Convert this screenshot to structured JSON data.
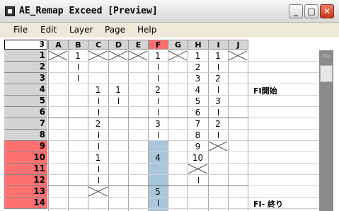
{
  "window": {
    "title": "AE_Remap Exceed [Preview]"
  },
  "menu": [
    "File",
    "Edit",
    "Layer",
    "Page",
    "Help"
  ],
  "frame_box": "3",
  "columns": [
    "A",
    "B",
    "C",
    "D",
    "E",
    "F",
    "G",
    "H",
    "I",
    "J"
  ],
  "selected_column": "F",
  "rows": [
    "1",
    "2",
    "3",
    "4",
    "5",
    "6",
    "7",
    "8",
    "9",
    "10",
    "11",
    "12",
    "13",
    "14"
  ],
  "red_rows": [
    "9",
    "10",
    "11",
    "12",
    "13",
    "14"
  ],
  "memos": [
    {
      "row": 4,
      "text": "FI開始"
    },
    {
      "row": 14,
      "text": "FI- 終り"
    }
  ],
  "scroll": {
    "top_label": "Top"
  },
  "colors": {
    "selected_header": "#ff6f6f",
    "red_row": "#ff7070",
    "blue_fill": "#a9c8dc"
  },
  "cells": [
    {
      "r": 1,
      "c": "B",
      "v": "1"
    },
    {
      "r": 1,
      "c": "F",
      "v": "1"
    },
    {
      "r": 1,
      "c": "H",
      "v": "1"
    },
    {
      "r": 1,
      "c": "I",
      "v": "1"
    },
    {
      "r": 2,
      "c": "H",
      "v": "2"
    },
    {
      "r": 3,
      "c": "H",
      "v": "3"
    },
    {
      "r": 3,
      "c": "I",
      "v": "2"
    },
    {
      "r": 4,
      "c": "C",
      "v": "1"
    },
    {
      "r": 4,
      "c": "D",
      "v": "1"
    },
    {
      "r": 4,
      "c": "F",
      "v": "2"
    },
    {
      "r": 4,
      "c": "H",
      "v": "4"
    },
    {
      "r": 5,
      "c": "H",
      "v": "5"
    },
    {
      "r": 5,
      "c": "I",
      "v": "3"
    },
    {
      "r": 6,
      "c": "H",
      "v": "6"
    },
    {
      "r": 7,
      "c": "C",
      "v": "2"
    },
    {
      "r": 7,
      "c": "F",
      "v": "3"
    },
    {
      "r": 7,
      "c": "H",
      "v": "7"
    },
    {
      "r": 7,
      "c": "I",
      "v": "2"
    },
    {
      "r": 8,
      "c": "H",
      "v": "8"
    },
    {
      "r": 9,
      "c": "H",
      "v": "9"
    },
    {
      "r": 10,
      "c": "C",
      "v": "1"
    },
    {
      "r": 10,
      "c": "F",
      "v": "4"
    },
    {
      "r": 10,
      "c": "H",
      "v": "10"
    },
    {
      "r": 13,
      "c": "F",
      "v": "5"
    }
  ],
  "x_cells": [
    {
      "r": 1,
      "c": "A"
    },
    {
      "r": 1,
      "c": "C"
    },
    {
      "r": 1,
      "c": "D"
    },
    {
      "r": 1,
      "c": "E"
    },
    {
      "r": 1,
      "c": "G"
    },
    {
      "r": 1,
      "c": "J"
    },
    {
      "r": 9,
      "c": "I"
    },
    {
      "r": 11,
      "c": "H"
    },
    {
      "r": 13,
      "c": "C"
    }
  ],
  "dashes": [
    {
      "r": 2,
      "c": "B"
    },
    {
      "r": 3,
      "c": "B"
    },
    {
      "r": 2,
      "c": "F"
    },
    {
      "r": 3,
      "c": "F"
    },
    {
      "r": 2,
      "c": "I"
    },
    {
      "r": 4,
      "c": "I"
    },
    {
      "r": 5,
      "c": "C"
    },
    {
      "r": 6,
      "c": "C"
    },
    {
      "r": 5,
      "c": "D"
    },
    {
      "r": 5,
      "c": "F"
    },
    {
      "r": 6,
      "c": "F"
    },
    {
      "r": 6,
      "c": "I"
    },
    {
      "r": 8,
      "c": "C"
    },
    {
      "r": 9,
      "c": "C"
    },
    {
      "r": 8,
      "c": "F"
    },
    {
      "r": 8,
      "c": "I"
    },
    {
      "r": 11,
      "c": "C"
    },
    {
      "r": 12,
      "c": "C"
    },
    {
      "r": 12,
      "c": "H"
    },
    {
      "r": 14,
      "c": "F"
    }
  ],
  "blue_fill": {
    "c": "F",
    "from": 9,
    "to": 14
  }
}
